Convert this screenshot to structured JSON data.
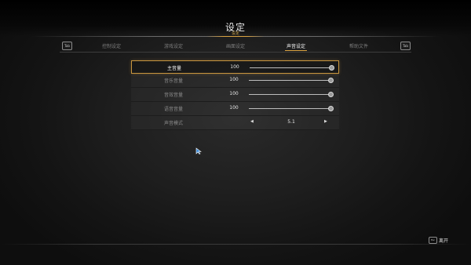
{
  "page": {
    "title": "设定",
    "subtitle": "设定"
  },
  "tabs": {
    "prev_key": "Tab",
    "next_key": "Tab",
    "items": [
      {
        "label": "控制设定",
        "active": false
      },
      {
        "label": "游戏设定",
        "active": false
      },
      {
        "label": "画面设定",
        "active": false
      },
      {
        "label": "声音设定",
        "active": true
      },
      {
        "label": "帮助文件",
        "active": false
      }
    ]
  },
  "settings": [
    {
      "label": "主音量",
      "value": "100",
      "level": 1.0,
      "selected": true
    },
    {
      "label": "音乐音量",
      "value": "100",
      "level": 1.0,
      "selected": false
    },
    {
      "label": "音效音量",
      "value": "100",
      "level": 1.0,
      "selected": false
    },
    {
      "label": "语音音量",
      "value": "100",
      "level": 1.0,
      "selected": false
    }
  ],
  "sound_mode": {
    "label": "声音模式",
    "value": "5.1",
    "left_arrow": "◀",
    "right_arrow": "▶"
  },
  "footer": {
    "leave_key": "Esc",
    "leave_label": "离开"
  },
  "colors": {
    "accent": "#d9a241",
    "cursor": "#3a8bdc"
  }
}
